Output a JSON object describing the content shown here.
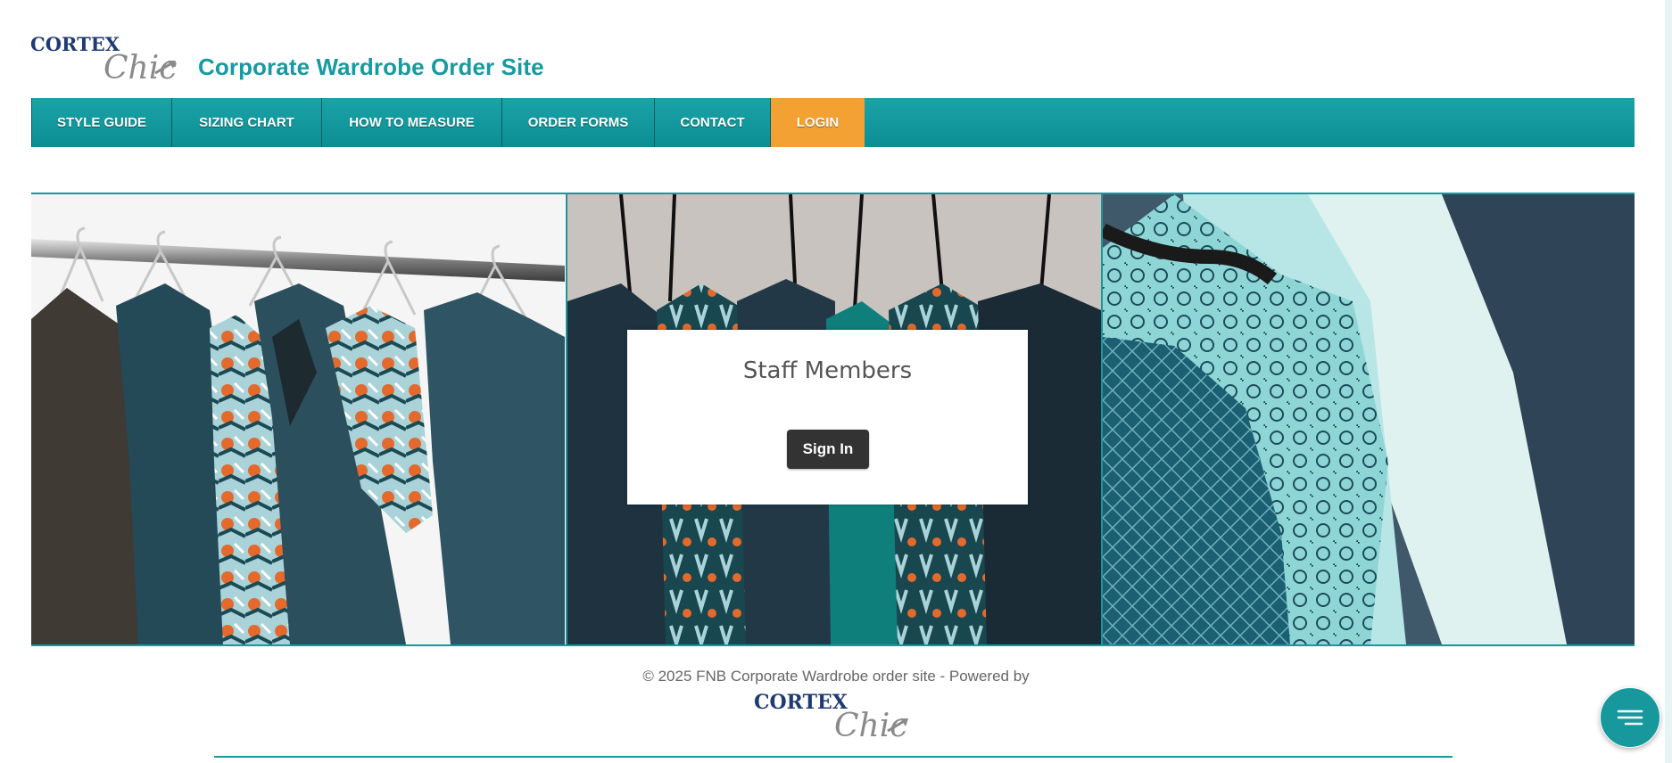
{
  "brand": {
    "logo_word": "CORTEX",
    "logo_script": "Chic",
    "site_title": "Corporate Wardrobe Order Site",
    "color_primary": "#17989d",
    "color_accent": "#f4a133",
    "color_logo": "#1f3b73"
  },
  "nav": {
    "items": [
      {
        "label": "Style Guide"
      },
      {
        "label": "Sizing Chart"
      },
      {
        "label": "How To Measure"
      },
      {
        "label": "Order Forms"
      },
      {
        "label": "Contact"
      },
      {
        "label": "Login",
        "active": true
      }
    ]
  },
  "login_card": {
    "title": "Staff Members",
    "button_label": "Sign In"
  },
  "footer": {
    "text": "© 2025 FNB Corporate Wardrobe order site - Powered by"
  },
  "chat": {
    "icon": "menu-lines-icon"
  }
}
